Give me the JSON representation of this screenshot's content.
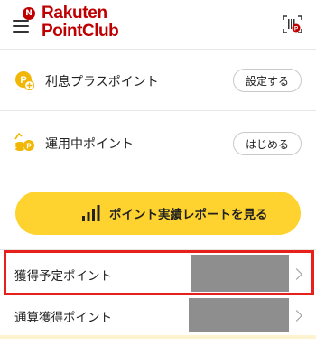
{
  "header": {
    "notification_badge": "N",
    "logo_line1": "Rakuten",
    "logo_line2": "PointClub"
  },
  "rows": {
    "interest_plus": {
      "label": "利息プラスポイント",
      "button": "設定する"
    },
    "investing": {
      "label": "運用中ポイント",
      "button": "はじめる"
    }
  },
  "report_button": {
    "label": "ポイント実績レポートを見る"
  },
  "points": {
    "expected": {
      "label": "獲得予定ポイント"
    },
    "total": {
      "label": "通算獲得ポイント"
    }
  },
  "colors": {
    "brand_red": "#bf0000",
    "accent_yellow": "#fed32f",
    "highlight_red": "#e8201c",
    "redacted_gray": "#8e8e8e"
  }
}
